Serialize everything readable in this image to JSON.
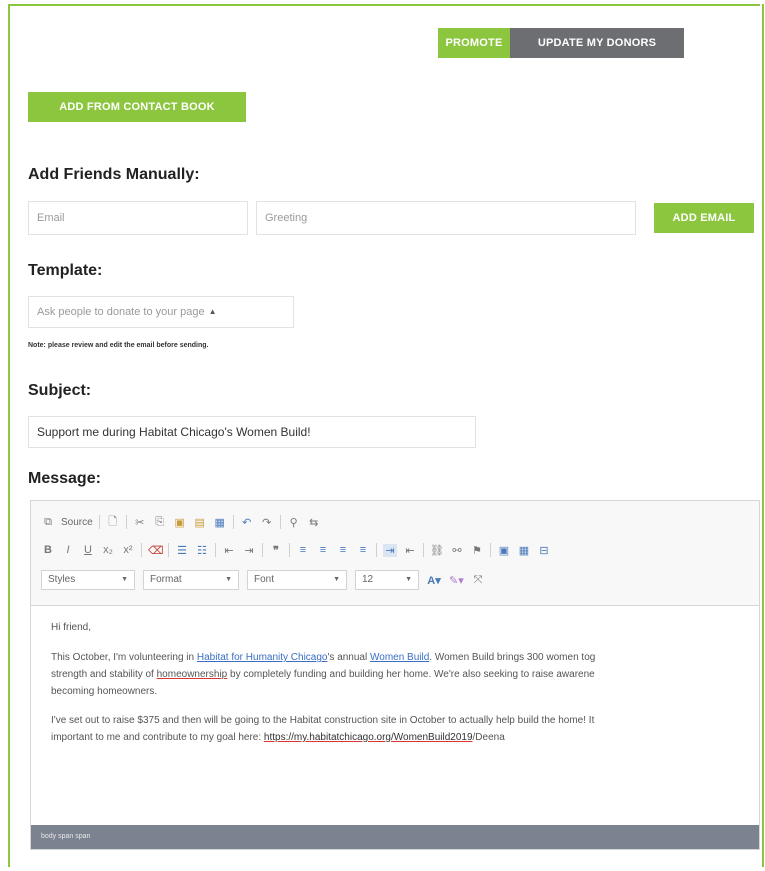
{
  "tabs": {
    "promote": "PROMOTE",
    "update_donors": "UPDATE MY DONORS"
  },
  "add_from_contact_book": "ADD FROM CONTACT BOOK",
  "add_friends": {
    "heading": "Add Friends Manually:",
    "email_placeholder": "Email",
    "greeting_placeholder": "Greeting",
    "add_email_button": "ADD EMAIL"
  },
  "template": {
    "heading": "Template:",
    "selected": "Ask people to donate to your page",
    "note": "Note: please review and edit the email before sending."
  },
  "subject": {
    "heading": "Subject:",
    "value": "Support me during Habitat Chicago's Women Build!"
  },
  "message": {
    "heading": "Message:",
    "toolbar": {
      "source_label": "Source",
      "styles": "Styles",
      "format": "Format",
      "font": "Font",
      "size": "12"
    },
    "greeting": "Hi friend,",
    "para1_a": "This October, I'm volunteering in ",
    "para1_link1": "Habitat for Humanity Chicago",
    "para1_b": "'s annual ",
    "para1_link2": "Women Build",
    "para1_c": ". Women Build brings 300 women tog",
    "para1_line2_a": "strength and stability of ",
    "para1_line2_spell": "homeownership",
    "para1_line2_b": " by completely funding and building her home. We're also seeking to raise awarene",
    "para1_line3": "becoming homeowners.",
    "para2_line1": "I've set out to raise $375 and then will be going to the Habitat construction site in October to actually help build the home! It",
    "para2_line2_a": "important to me and contribute to my goal here: ",
    "para2_link": "https://my.habitatchicago.org/WomenBuild2019",
    "para2_line2_b": "/Deena",
    "statusbar": "body  span  span"
  }
}
